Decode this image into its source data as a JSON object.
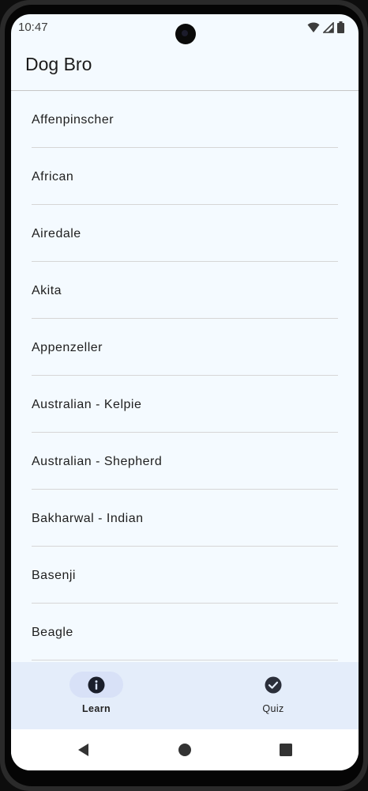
{
  "status_bar": {
    "time": "10:47",
    "icons": [
      "wifi-icon",
      "cell-signal-icon",
      "battery-icon"
    ]
  },
  "app_bar": {
    "title": "Dog Bro"
  },
  "breeds": [
    "Affenpinscher",
    "African",
    "Airedale",
    "Akita",
    "Appenzeller",
    "Australian - Kelpie",
    "Australian - Shepherd",
    "Bakharwal - Indian",
    "Basenji",
    "Beagle"
  ],
  "bottom_nav": {
    "items": [
      {
        "label": "Learn",
        "icon": "info-icon",
        "selected": true
      },
      {
        "label": "Quiz",
        "icon": "check-circle-icon",
        "selected": false
      }
    ]
  },
  "system_nav": {
    "buttons": [
      "back-icon",
      "home-icon",
      "recents-icon"
    ]
  },
  "colors": {
    "background": "#f4faff",
    "nav_background": "#e4edfa",
    "nav_indicator": "#d8e1f7",
    "divider": "#d6d6d6",
    "icon": "#1b1f2b"
  }
}
